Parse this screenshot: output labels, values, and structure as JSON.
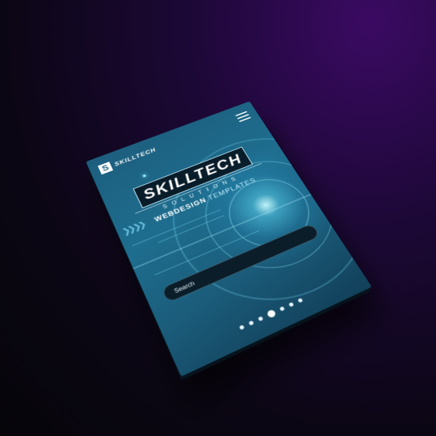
{
  "header": {
    "logo_mark": "S",
    "logo_text": "SKILLTECH"
  },
  "hero": {
    "brand_main": "SKILLTECH",
    "brand_sub": "SOLUTIONS",
    "template_bold": "WEBDESIGN",
    "template_thin": " TEMPLATES"
  },
  "search": {
    "placeholder": "Search"
  },
  "pager": {
    "count": 7,
    "active_index": 3
  },
  "colors": {
    "background": "#1c0836",
    "screen": "#1f6e8f",
    "accent": "#8ef2ff"
  }
}
